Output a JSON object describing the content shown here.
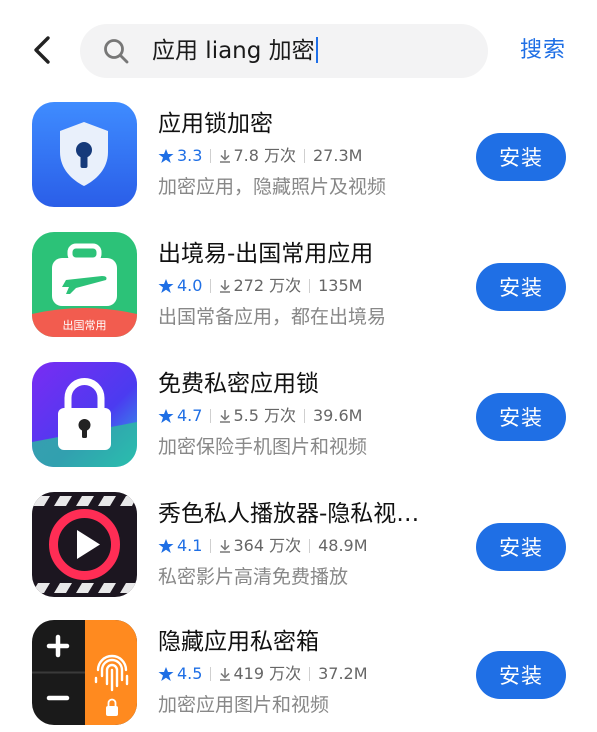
{
  "header": {
    "back_icon": "chevron-left-icon",
    "search_icon": "search-icon",
    "query": "应用 liang 加密",
    "search_label": "搜索"
  },
  "colors": {
    "accent": "#1f6fe5",
    "text_primary": "#111111",
    "text_secondary": "#888888",
    "search_bg": "#f3f3f4"
  },
  "apps": [
    {
      "name": "应用锁加密",
      "rating": "3.3",
      "downloads": "7.8 万次",
      "size": "27.3M",
      "desc": "加密应用，隐藏照片及视频",
      "install": "安装",
      "icon": "shield-lock-icon"
    },
    {
      "name": "出境易-出国常用应用",
      "rating": "4.0",
      "downloads": "272 万次",
      "size": "135M",
      "desc": "出国常备应用，都在出境易",
      "install": "安装",
      "icon": "suitcase-plane-icon",
      "icon_label": "出国常用"
    },
    {
      "name": "免费私密应用锁",
      "rating": "4.7",
      "downloads": "5.5 万次",
      "size": "39.6M",
      "desc": "加密保险手机图片和视频",
      "install": "安装",
      "icon": "padlock-icon"
    },
    {
      "name": "秀色私人播放器-隐私视…",
      "rating": "4.1",
      "downloads": "364 万次",
      "size": "48.9M",
      "desc": "私密影片高清免费播放",
      "install": "安装",
      "icon": "play-button-icon"
    },
    {
      "name": "隐藏应用私密箱",
      "rating": "4.5",
      "downloads": "419 万次",
      "size": "37.2M",
      "desc": "加密应用图片和视频",
      "install": "安装",
      "icon": "calculator-fingerprint-icon"
    }
  ]
}
